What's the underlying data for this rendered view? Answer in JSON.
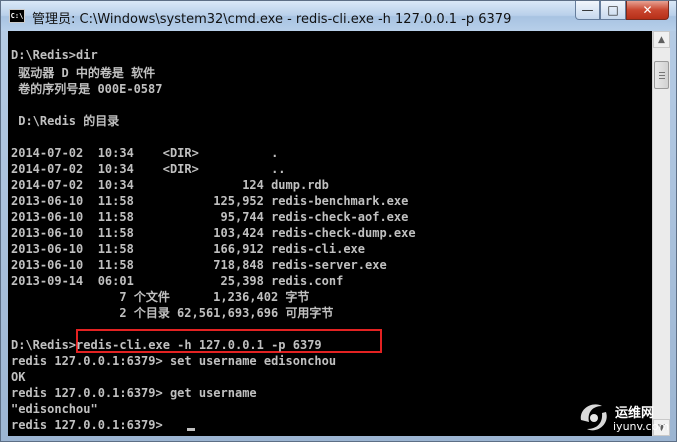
{
  "window": {
    "title": "管理员: C:\\Windows\\system32\\cmd.exe - redis-cli.exe  -h 127.0.0.1 -p 6379",
    "icon_label": "C:\\",
    "minimize_symbol": "—",
    "maximize_symbol": "□",
    "close_symbol": "✕"
  },
  "console": {
    "lines": [
      "D:\\Redis>dir",
      " 驱动器 D 中的卷是 软件",
      " 卷的序列号是 000E-0587",
      "",
      " D:\\Redis 的目录",
      "",
      "2014-07-02  10:34    <DIR>          .",
      "2014-07-02  10:34    <DIR>          ..",
      "2014-07-02  10:34               124 dump.rdb",
      "2013-06-10  11:58           125,952 redis-benchmark.exe",
      "2013-06-10  11:58            95,744 redis-check-aof.exe",
      "2013-06-10  11:58           103,424 redis-check-dump.exe",
      "2013-06-10  11:58           166,912 redis-cli.exe",
      "2013-06-10  11:58           718,848 redis-server.exe",
      "2013-09-14  06:01            25,398 redis.conf",
      "               7 个文件      1,236,402 字节",
      "               2 个目录 62,561,693,696 可用字节",
      "",
      "D:\\Redis>redis-cli.exe -h 127.0.0.1 -p 6379",
      "redis 127.0.0.1:6379> set username edisonchou",
      "OK",
      "redis 127.0.0.1:6379> get username",
      "\"edisonchou\"",
      "redis 127.0.0.1:6379> "
    ]
  },
  "scrollbar": {
    "up_symbol": "▲",
    "down_symbol": "▼"
  },
  "watermark": {
    "name": "运维网",
    "url": "iyunv.com"
  },
  "colors": {
    "console_bg": "#000000",
    "console_fg": "#c0c0c0",
    "highlight_box": "#e32222"
  }
}
